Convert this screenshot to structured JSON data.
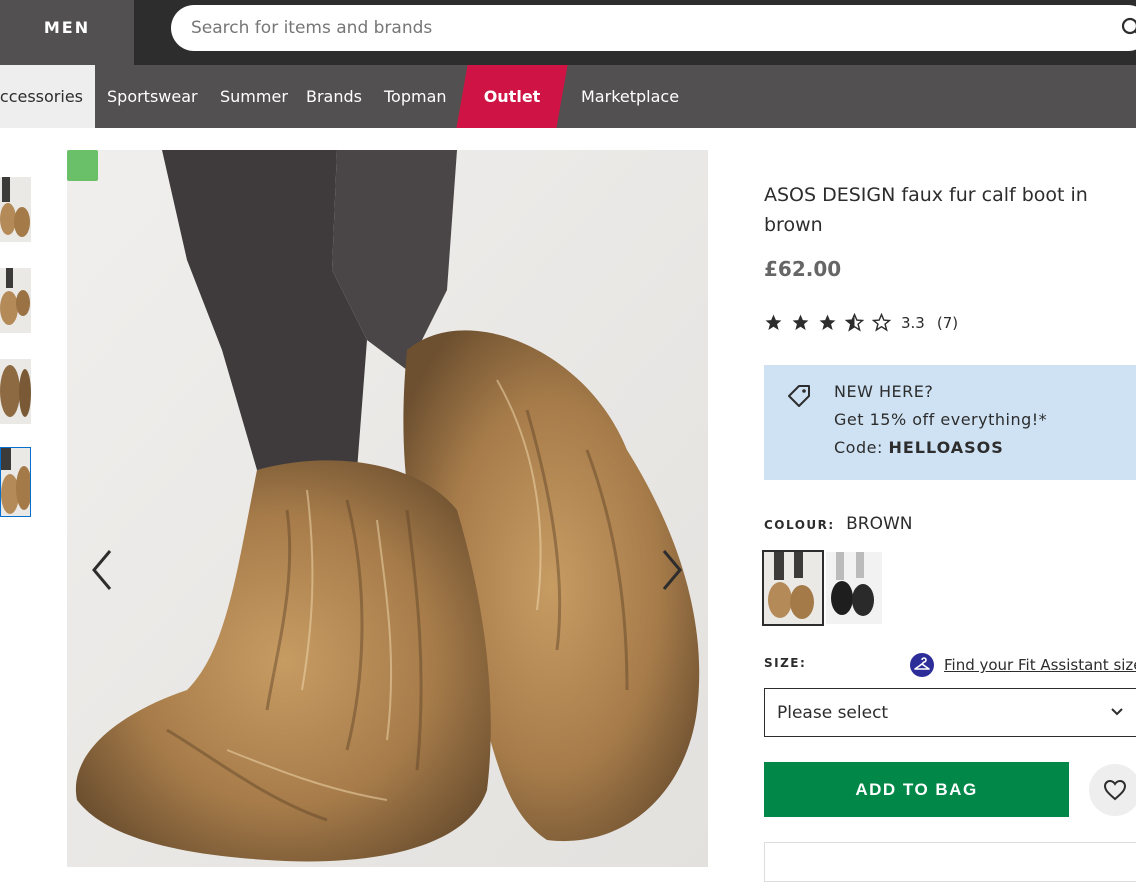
{
  "header": {
    "men_label": "MEN",
    "search_placeholder": "Search for items and brands"
  },
  "nav": {
    "items": [
      "Accessories",
      "Sportswear",
      "Summer",
      "Brands",
      "Topman",
      "Outlet",
      "Marketplace"
    ]
  },
  "product": {
    "title": "ASOS DESIGN faux fur calf boot in brown",
    "price": "£62.00",
    "rating": "3.3",
    "reviews": "(7)",
    "stars_filled": 3.3,
    "stars_total": 5
  },
  "promo": {
    "line1": "NEW HERE?",
    "line2": "Get 15% off everything!*",
    "code_label": "Code:",
    "code": "HELLOASOS"
  },
  "colour": {
    "label": "COLOUR:",
    "value": "BROWN"
  },
  "size": {
    "label": "SIZE:",
    "fit_link": "Find your Fit Assistant size",
    "select_value": "Please select"
  },
  "actions": {
    "add_to_bag": "ADD TO BAG"
  },
  "colors": {
    "topbar": "#2d2d2d",
    "navbar": "#525050",
    "outlet": "#d01345",
    "promo_bg": "#cfe2f4",
    "add_to_bag": "#018849"
  }
}
